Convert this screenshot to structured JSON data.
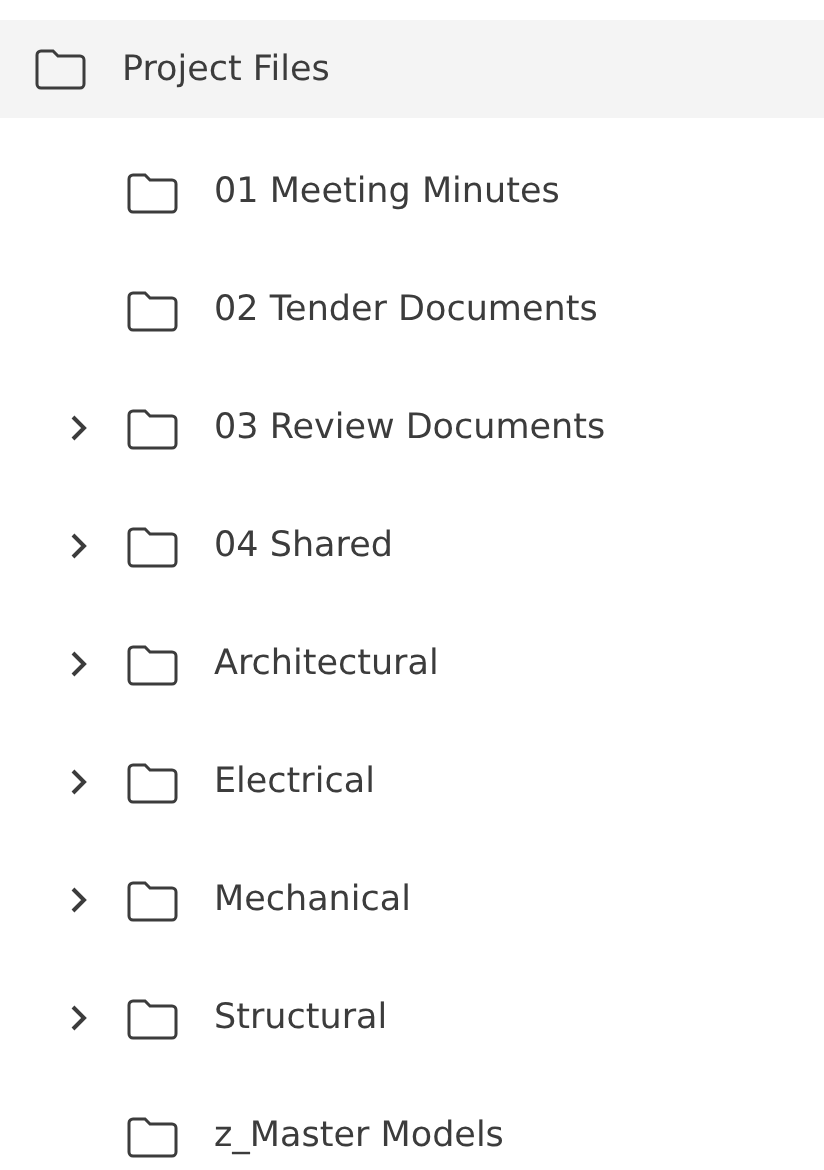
{
  "tree": {
    "label": "Project Files",
    "children": [
      {
        "label": "01 Meeting Minutes",
        "expandable": false
      },
      {
        "label": "02 Tender Documents",
        "expandable": false
      },
      {
        "label": "03 Review Documents",
        "expandable": true
      },
      {
        "label": "04 Shared",
        "expandable": true
      },
      {
        "label": "Architectural",
        "expandable": true
      },
      {
        "label": "Electrical",
        "expandable": true
      },
      {
        "label": "Mechanical",
        "expandable": true
      },
      {
        "label": "Structural",
        "expandable": true
      },
      {
        "label": "z_Master Models",
        "expandable": false
      }
    ]
  }
}
